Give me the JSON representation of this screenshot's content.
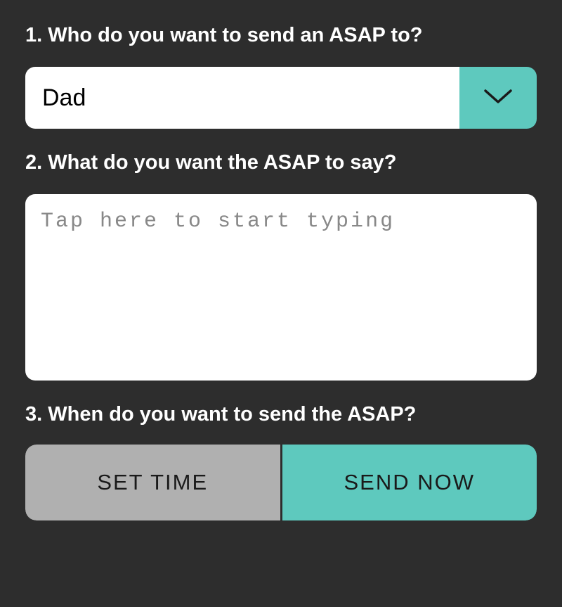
{
  "sections": {
    "recipient": {
      "label": "1. Who do you want to send an ASAP to?",
      "selected": "Dad"
    },
    "message": {
      "label": "2. What do you want the ASAP to say?",
      "placeholder": "Tap here to start typing",
      "value": ""
    },
    "timing": {
      "label": "3. When do you want to send the ASAP?",
      "buttons": {
        "setTime": "SET TIME",
        "sendNow": "SEND NOW"
      }
    }
  },
  "colors": {
    "accent": "#5ec9be",
    "background": "#2d2d2d",
    "inactive": "#b0b0b0"
  }
}
